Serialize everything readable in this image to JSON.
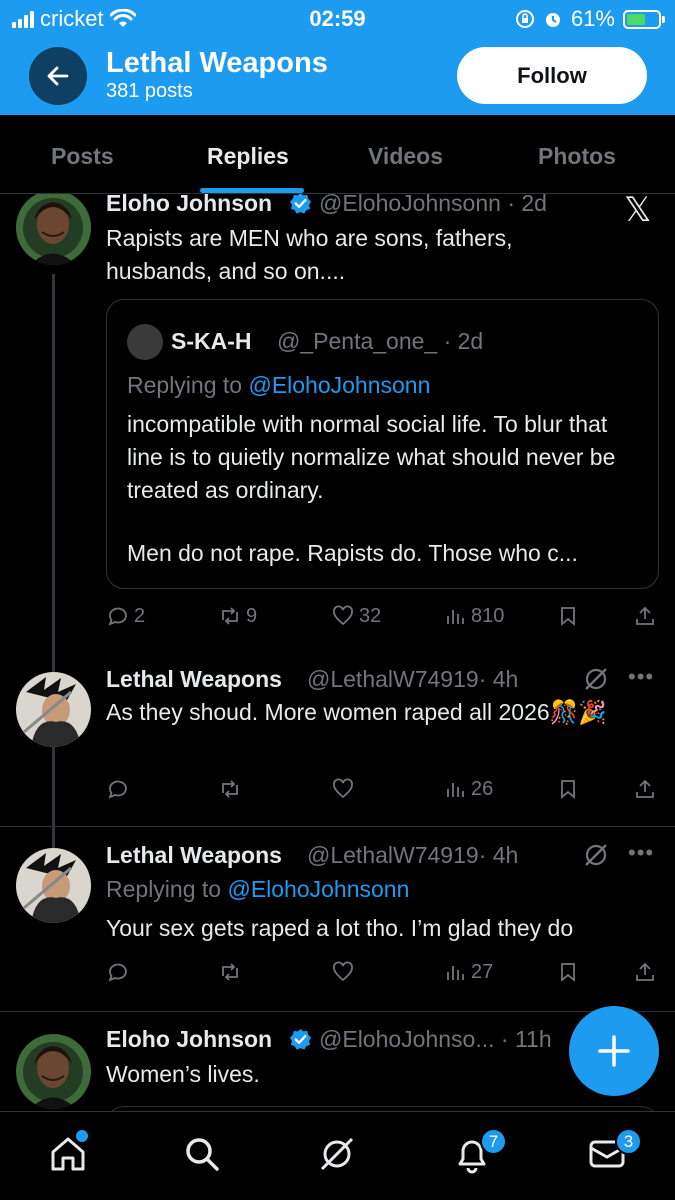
{
  "status_bar": {
    "carrier": "cricket",
    "time": "02:59",
    "battery": "61%",
    "battery_level": 0.61
  },
  "header": {
    "title": "Lethal Weapons",
    "subtitle": "381 posts",
    "follow_label": "Follow"
  },
  "tabs": [
    {
      "label": "Posts",
      "active": false
    },
    {
      "label": "Replies",
      "active": true
    },
    {
      "label": "Videos",
      "active": false
    },
    {
      "label": "Photos",
      "active": false
    }
  ],
  "posts": [
    {
      "name": "Eloho Johnson",
      "handle": "@ElohoJohnsonn",
      "time": "· 2d",
      "verified": true,
      "text": "Rapists are MEN who are sons, fathers, husbands, and so on....",
      "quote": {
        "name": "S-KA-H",
        "handle": "@_Penta_one_",
        "time": "· 2d",
        "reply_prefix": "Replying to ",
        "reply_mention": "@ElohoJohnsonn",
        "text": "incompatible with normal social life. To blur that line is to quietly normalize what should never be treated as ordinary.",
        "text2": "Men do not rape. Rapists do. Those who c..."
      },
      "stats": {
        "replies": "2",
        "reposts": "9",
        "likes": "32",
        "views": "810"
      }
    },
    {
      "name": "Lethal Weapons",
      "handle": "@LethalW74919",
      "time": "· 4h",
      "text": "As they shoud. More women raped all 2026🎊🎉",
      "stats": {
        "replies": "",
        "reposts": "",
        "likes": "",
        "views": "26"
      }
    },
    {
      "name": "Lethal Weapons",
      "handle": "@LethalW74919",
      "time": "· 4h",
      "reply_prefix": "Replying to ",
      "reply_mention": "@ElohoJohnsonn",
      "text": "Your sex gets raped a lot tho. I’m glad they do",
      "stats": {
        "replies": "",
        "reposts": "",
        "likes": "",
        "views": "27"
      }
    },
    {
      "name": "Eloho Johnson",
      "handle": "@ElohoJohnso...",
      "time": "· 11h",
      "verified": true,
      "text": "Women’s lives."
    }
  ],
  "nav": {
    "notifications_badge": "7",
    "messages_badge": "3"
  },
  "colors": {
    "accent": "#1d9bf0",
    "background": "#000000",
    "muted": "#71767b"
  }
}
